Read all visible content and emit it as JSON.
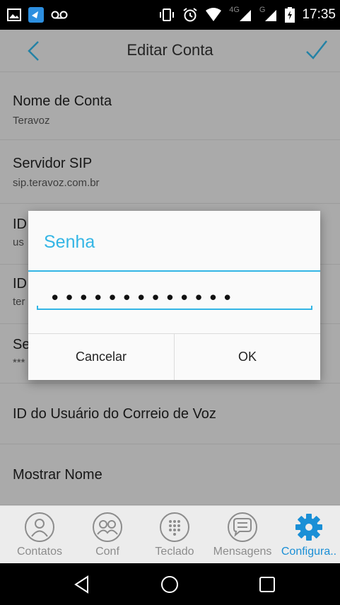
{
  "status_bar": {
    "time": "17:35",
    "network_label_1": "4G",
    "network_label_2": "G",
    "icons": [
      "image-icon",
      "teravoz-app-icon",
      "voicemail-icon",
      "vibrate-icon",
      "alarm-icon",
      "wifi-icon",
      "signal-icon",
      "battery-charging-icon"
    ]
  },
  "app_bar": {
    "title": "Editar Conta",
    "back_icon": "back-chevron-icon",
    "confirm_icon": "check-icon"
  },
  "settings": [
    {
      "label": "Nome de Conta",
      "value": "Teravoz"
    },
    {
      "label": "Servidor SIP",
      "value": "sip.teravoz.com.br"
    },
    {
      "label": "ID",
      "value": "us"
    },
    {
      "label": "ID",
      "value": "ter"
    },
    {
      "label": "Se",
      "value": "***"
    },
    {
      "label": "ID do Usuário do Correio de Voz",
      "value": ""
    },
    {
      "label": "Mostrar Nome",
      "value": ""
    }
  ],
  "dialog": {
    "title": "Senha",
    "password_value": "•••••••••••••",
    "cancel_label": "Cancelar",
    "ok_label": "OK"
  },
  "tabs": [
    {
      "label": "Contatos",
      "icon": "contacts-icon",
      "active": false
    },
    {
      "label": "Conf",
      "icon": "conference-icon",
      "active": false
    },
    {
      "label": "Teclado",
      "icon": "keypad-icon",
      "active": false
    },
    {
      "label": "Mensagens",
      "icon": "messages-icon",
      "active": false
    },
    {
      "label": "Configura..",
      "icon": "settings-gear-icon",
      "active": true
    }
  ],
  "nav_bar": {
    "icons": [
      "nav-back-icon",
      "nav-home-icon",
      "nav-recents-icon"
    ]
  },
  "colors": {
    "accent": "#33b5e5",
    "tab_active": "#1a8fd6",
    "status_bar": "#000000"
  }
}
